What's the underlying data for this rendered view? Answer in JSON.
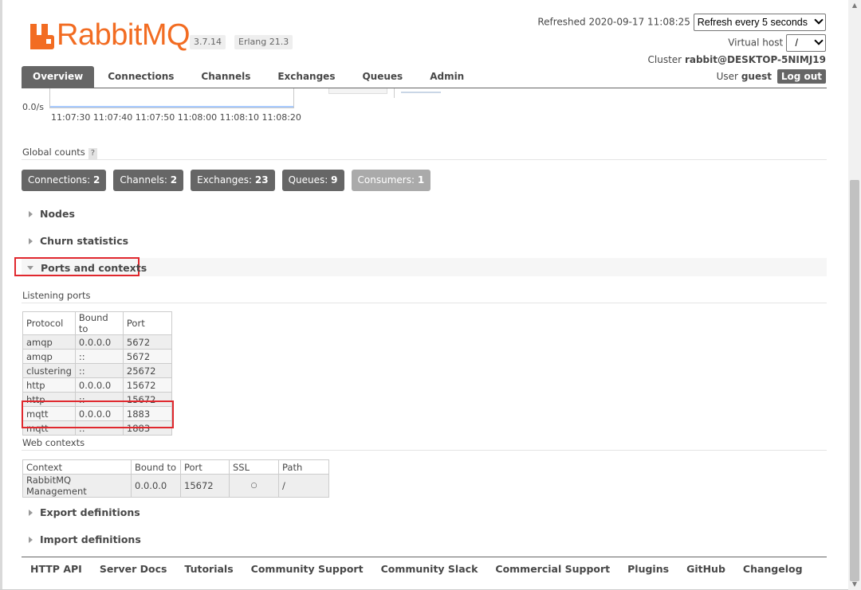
{
  "header": {
    "logo_text": "RabbitMQ",
    "logo_tm": "TM",
    "version": "3.7.14",
    "erlang": "Erlang 21.3",
    "refreshed_label": "Refreshed 2020-09-17 11:08:25",
    "refresh_select": "Refresh every 5 seconds",
    "vhost_label": "Virtual host",
    "vhost_value": "/",
    "cluster_label": "Cluster",
    "cluster_value": "rabbit@DESKTOP-5NIMJ19",
    "user_label": "User",
    "user_value": "guest",
    "logout_label": "Log out"
  },
  "tabs": [
    {
      "label": "Overview",
      "active": true
    },
    {
      "label": "Connections"
    },
    {
      "label": "Channels"
    },
    {
      "label": "Exchanges"
    },
    {
      "label": "Queues"
    },
    {
      "label": "Admin"
    }
  ],
  "chart": {
    "y_rate": "0.0/s",
    "ticks": "11:07:30 11:07:40 11:07:50 11:08:00 11:08:10 11:08:20"
  },
  "global_counts": {
    "label": "Global counts",
    "help": "?",
    "items": [
      {
        "label": "Connections:",
        "value": "2"
      },
      {
        "label": "Channels:",
        "value": "2"
      },
      {
        "label": "Exchanges:",
        "value": "23"
      },
      {
        "label": "Queues:",
        "value": "9"
      },
      {
        "label": "Consumers:",
        "value": "1"
      }
    ]
  },
  "sections": {
    "nodes": "Nodes",
    "churn": "Churn statistics",
    "ports": "Ports and contexts",
    "export": "Export definitions",
    "import": "Import definitions"
  },
  "listening_ports": {
    "label": "Listening ports",
    "headers": [
      "Protocol",
      "Bound to",
      "Port"
    ],
    "rows": [
      [
        "amqp",
        "0.0.0.0",
        "5672"
      ],
      [
        "amqp",
        "::",
        "5672"
      ],
      [
        "clustering",
        "::",
        "25672"
      ],
      [
        "http",
        "0.0.0.0",
        "15672"
      ],
      [
        "http",
        "::",
        "15672"
      ],
      [
        "mqtt",
        "0.0.0.0",
        "1883"
      ],
      [
        "mqtt",
        "::",
        "1883"
      ]
    ]
  },
  "web_contexts": {
    "label": "Web contexts",
    "headers": [
      "Context",
      "Bound to",
      "Port",
      "SSL",
      "Path"
    ],
    "rows": [
      [
        "RabbitMQ Management",
        "0.0.0.0",
        "15672",
        "○",
        "/"
      ]
    ]
  },
  "footer": [
    "HTTP API",
    "Server Docs",
    "Tutorials",
    "Community Support",
    "Community Slack",
    "Commercial Support",
    "Plugins",
    "GitHub",
    "Changelog"
  ]
}
